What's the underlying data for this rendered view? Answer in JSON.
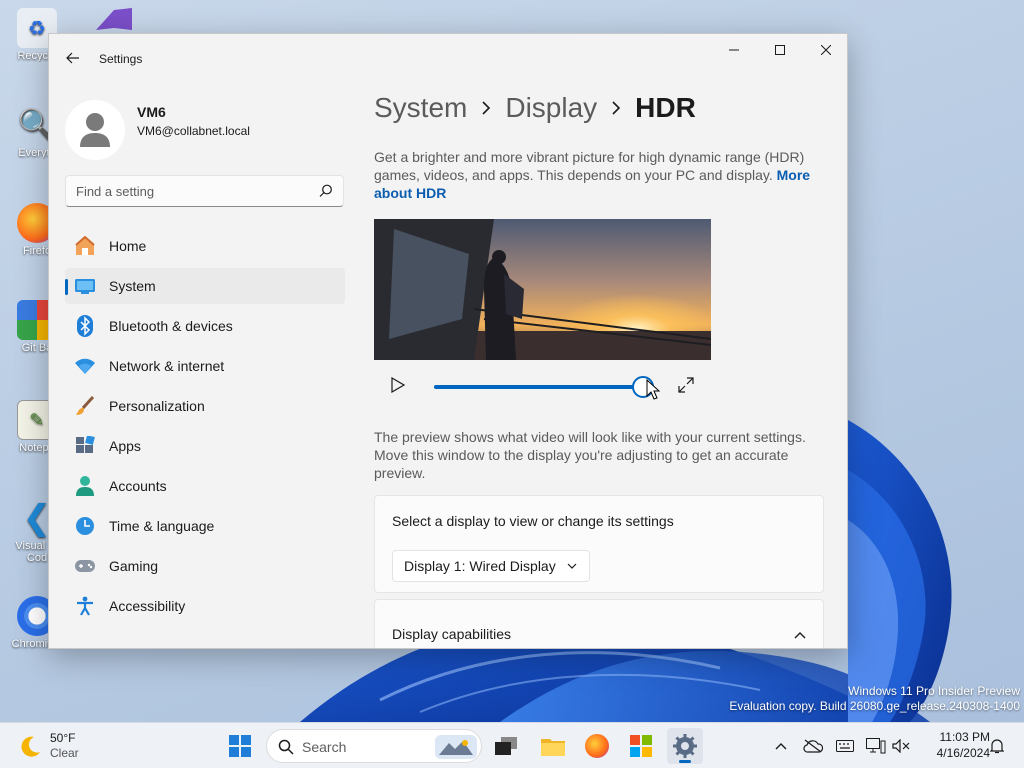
{
  "desktop": {
    "icons": [
      {
        "label": "Recycle",
        "icon": "recycle-bin-icon"
      },
      {
        "label": "Everyth",
        "icon": "everything-search-icon"
      },
      {
        "label": "Firefo",
        "icon": "firefox-icon"
      },
      {
        "label": "Git Ba",
        "icon": "git-bash-icon"
      },
      {
        "label": "Notepa",
        "icon": "notepad-plus-icon"
      },
      {
        "label": "Visual St",
        "label2": "Cod",
        "icon": "vscode-icon"
      },
      {
        "label": "Chromium",
        "icon": "chromium-icon"
      }
    ]
  },
  "window": {
    "title": "Settings",
    "profile": {
      "name": "VM6",
      "email": "VM6@collabnet.local"
    },
    "search": {
      "placeholder": "Find a setting"
    },
    "nav": [
      {
        "label": "Home",
        "icon": "home-icon"
      },
      {
        "label": "System",
        "icon": "system-icon",
        "active": true
      },
      {
        "label": "Bluetooth & devices",
        "icon": "bluetooth-icon"
      },
      {
        "label": "Network & internet",
        "icon": "network-icon"
      },
      {
        "label": "Personalization",
        "icon": "brush-icon"
      },
      {
        "label": "Apps",
        "icon": "apps-icon"
      },
      {
        "label": "Accounts",
        "icon": "accounts-icon"
      },
      {
        "label": "Time & language",
        "icon": "clock-globe-icon"
      },
      {
        "label": "Gaming",
        "icon": "gamepad-icon"
      },
      {
        "label": "Accessibility",
        "icon": "accessibility-icon"
      }
    ]
  },
  "content": {
    "breadcrumb": [
      "System",
      "Display",
      "HDR"
    ],
    "description": "Get a brighter and more vibrant picture for high dynamic range (HDR) games, videos, and apps. This depends on your PC and display.",
    "more_link": "More about HDR",
    "video": {
      "progress": 0.95
    },
    "preview_note": "The preview shows what video will look like with your current settings. Move this window to the display you're adjusting to get an accurate preview.",
    "select_card": {
      "title": "Select a display to view or change its settings",
      "dropdown_value": "Display 1: Wired Display"
    },
    "capabilities_card": {
      "title": "Display capabilities"
    }
  },
  "watermark": {
    "line1": "Windows 11 Pro Insider Preview",
    "line2": "Evaluation copy. Build 26080.ge_release.240308-1400"
  },
  "taskbar": {
    "weather": {
      "temp": "50°F",
      "condition": "Clear"
    },
    "search_label": "Search",
    "clock": {
      "time": "11:03 PM",
      "date": "4/16/2024"
    }
  },
  "colors": {
    "accent": "#0067c0",
    "link": "#0a5db0"
  }
}
